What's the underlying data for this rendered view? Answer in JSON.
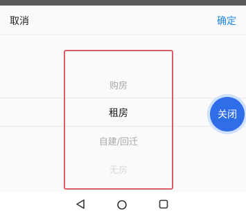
{
  "header": {
    "cancel_label": "取消",
    "confirm_label": "确定"
  },
  "picker": {
    "options": [
      "购房",
      "租房",
      "自建/回迁",
      "无房"
    ],
    "selected": "租房"
  },
  "floating": {
    "close_label": "关闭"
  },
  "navbar": {
    "icons": [
      "back-icon",
      "home-icon",
      "recents-icon"
    ]
  },
  "colors": {
    "accent": "#1e88e5",
    "close_button": "#2f6ee8",
    "highlight_border": "#e05a6a"
  }
}
